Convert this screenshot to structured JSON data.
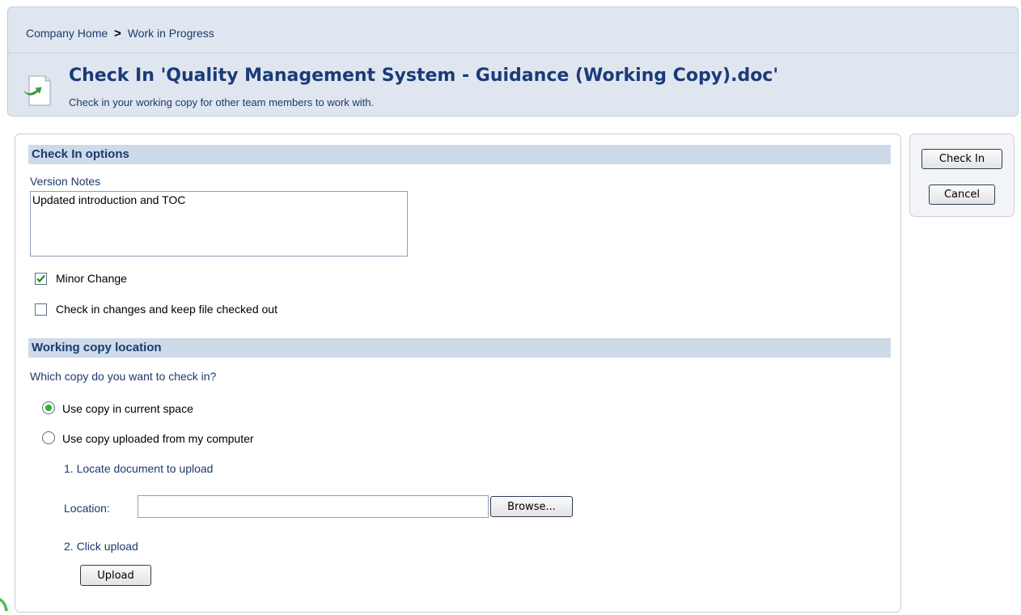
{
  "breadcrumb": {
    "home": "Company Home",
    "separator": ">",
    "current": "Work in Progress"
  },
  "page": {
    "title": "Check In 'Quality Management System - Guidance (Working Copy).doc'",
    "subtitle": "Check in your working copy for other team members to work with.",
    "icon": "document-checkin-icon"
  },
  "check_in_options": {
    "header": "Check In options",
    "version_notes_label": "Version Notes",
    "version_notes_value": "Updated introduction and TOC",
    "minor_change_label": "Minor Change",
    "minor_change_checked": true,
    "keep_checked_out_label": "Check in changes and keep file checked out",
    "keep_checked_out_checked": false
  },
  "working_copy": {
    "header": "Working copy location",
    "question": "Which copy do you want to check in?",
    "option_current_space": "Use copy in current space",
    "option_uploaded": "Use copy uploaded from my computer",
    "selected": "current_space",
    "step1": "1. Locate document to upload",
    "location_label": "Location:",
    "location_value": "",
    "browse_label": "Browse...",
    "step2": "2. Click upload",
    "upload_label": "Upload"
  },
  "actions": {
    "check_in_label": "Check In",
    "cancel_label": "Cancel"
  },
  "colors": {
    "header_bg": "#dfe6ef",
    "section_bg": "#cddbe9",
    "title_text": "#1a3a7a",
    "label_text": "#1c3a6b",
    "check_green": "#2bb32b"
  }
}
